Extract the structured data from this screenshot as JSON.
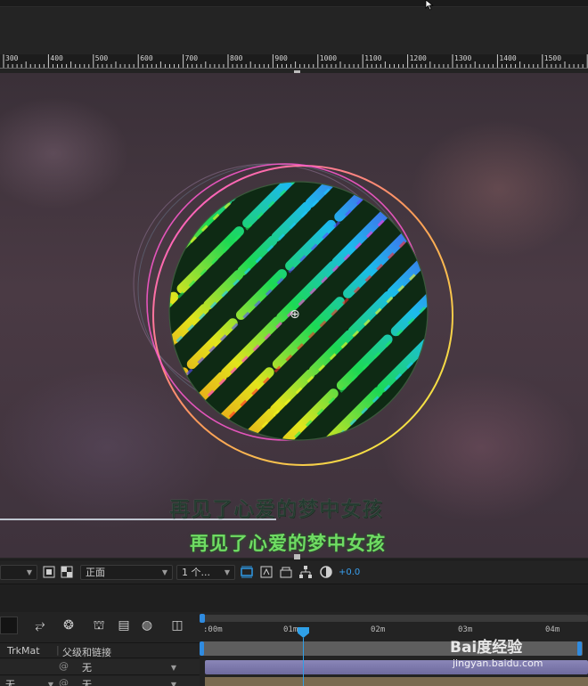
{
  "ruler": {
    "labels": [
      "300",
      "400",
      "500",
      "600",
      "700",
      "800",
      "900",
      "1000",
      "1100",
      "1200",
      "1300",
      "1400",
      "1500"
    ]
  },
  "viewer": {
    "subtitle_back": "再见了心爱的梦中女孩",
    "subtitle_front": "再见了心爱的梦中女孩"
  },
  "viewer_toolbar": {
    "view_dropdown": "正面",
    "views_dropdown": "1 个...",
    "exposure": "+0.0"
  },
  "timeline": {
    "time_labels": [
      ":00m",
      "01m",
      "02m",
      "03m",
      "04m"
    ],
    "columns": {
      "trkmat": "TrkMat",
      "parent": "父级和链接"
    },
    "rows": [
      {
        "trkmat": "",
        "parent": "无"
      },
      {
        "trkmat": "无",
        "parent": "无"
      }
    ]
  },
  "watermark": {
    "brand": "Bai度经验",
    "url": "jingyan.baidu.com"
  },
  "colors": {
    "accent": "#2f9ae6",
    "subtitle_green": "#6fdc63"
  }
}
